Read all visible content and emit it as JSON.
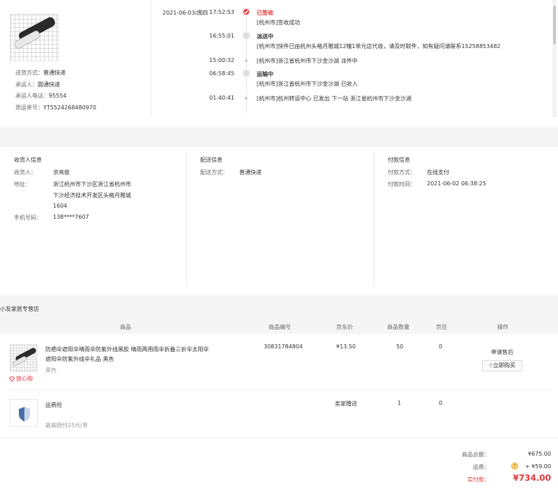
{
  "delivery": {
    "method_label": "送货方式：",
    "method_value": "普通快递",
    "carrier_label": "承运人：",
    "carrier_value": "圆通快递",
    "phone_label": "承运人电话：",
    "phone_value": "95554",
    "tracking_label": "货运单号：",
    "tracking_value": "YT5524268480970"
  },
  "timeline": [
    {
      "date": "2021-06-03/周四",
      "time": "17:52:53",
      "status": "已签收",
      "detail": "[杭州市]签收成功"
    },
    {
      "date": "",
      "time": "16:55:01",
      "status": "派送中",
      "detail": "[杭州市]快件已由杭州头格月雅城12幢1单元店代收，请及时取件，如有疑问请联系15258853482"
    },
    {
      "date": "",
      "time": "15:00:32",
      "status": "",
      "detail": "[杭州市]浙江省杭州市下沙金沙湖 派件中"
    },
    {
      "date": "",
      "time": "06:58:45",
      "status": "运输中",
      "detail": "[杭州市]浙江省杭州市下沙金沙湖 已收入"
    },
    {
      "date": "",
      "time": "01:40:41",
      "status": "",
      "detail": "[杭州市]杭州转运中心 已发出 下一站 浙江省杭州市下沙金沙湖"
    }
  ],
  "receiver": {
    "title": "收货人信息",
    "name_label": "收货人：",
    "name_value": "余亮俊",
    "addr_label": "地址：",
    "addr_line1": "浙江杭州市下沙区浙江省杭州市",
    "addr_line2": "下沙经济技术开发区头格月雅城",
    "addr_line3": "1604",
    "phone_label": "手机号码：",
    "phone_value": "138****7607"
  },
  "shipping": {
    "title": "配送信息",
    "method_label": "配送方式：",
    "method_value": "普通快递"
  },
  "payment": {
    "title": "付款信息",
    "method_label": "付款方式：",
    "method_value": "在线支付",
    "time_label": "付款时间：",
    "time_value": "2021-06-02 06:38:25"
  },
  "shop": {
    "name": "小友家居专营店"
  },
  "table": {
    "headers": [
      "商品",
      "商品编号",
      "京东价",
      "商品数量",
      "京豆",
      "操作"
    ],
    "item": {
      "title_line1": "防晒伞遮阳伞晴雨伞防紫外线黑胶 晴雨两用雨伞折叠三折伞太阳伞",
      "title_line2": "遮阳伞防紫外线伞礼品 黑色",
      "variant": "黑色",
      "badge": "放心购",
      "sku": "30831784804",
      "price": "¥13.50",
      "qty": "50",
      "beans": "0",
      "action_link": "申请售后",
      "action_button": "立即购买"
    },
    "insurance": {
      "title": "运费险",
      "note": "最高赔付25元/单",
      "price": "卖家赠送",
      "qty": "1",
      "beans": "0"
    }
  },
  "summary": {
    "goods_label": "商品总额：",
    "goods_value": "¥675.00",
    "freight_label": "运费：",
    "freight_value": "+ ¥59.00",
    "paid_label": "实付款：",
    "paid_value": "¥734.00"
  }
}
